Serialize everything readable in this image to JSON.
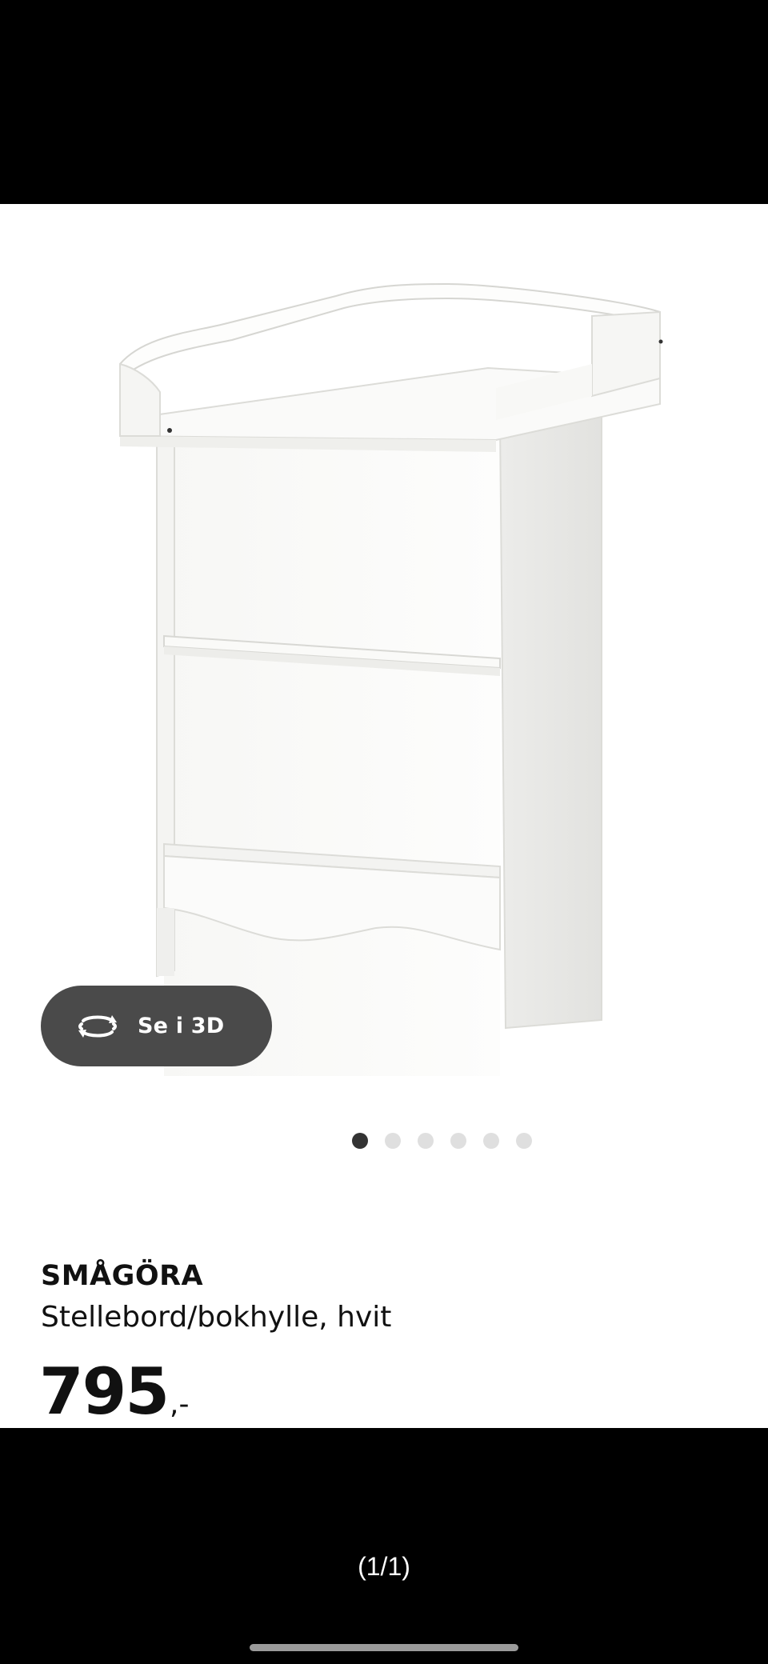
{
  "viewer": {
    "view_3d_label": "Se i 3D",
    "rotate_icon": "rotate-3d-icon",
    "carousel": {
      "total": 6,
      "active_index": 0
    },
    "page_counter": "(1/1)"
  },
  "product": {
    "name": "SMÅGÖRA",
    "description": "Stellebord/bokhylle, hvit",
    "price_integer": "795",
    "price_suffix": ",-"
  },
  "colors": {
    "button_bg": "#4a4a4a",
    "dot_active": "#333333",
    "dot_inactive": "#dfdfdf"
  }
}
